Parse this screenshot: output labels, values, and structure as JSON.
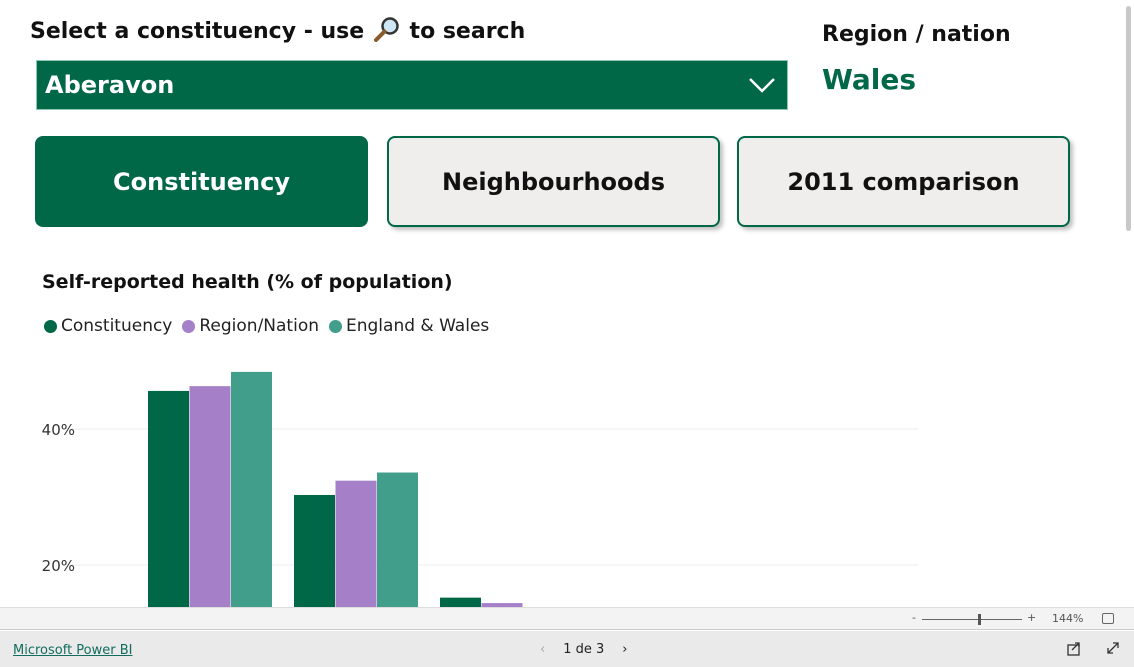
{
  "header": {
    "select_label": "Select a constituency - use",
    "select_label_suffix": "to search",
    "search_icon": "magnifier-icon",
    "dropdown_value": "Aberavon",
    "region_label": "Region / nation",
    "region_value": "Wales"
  },
  "tabs": [
    {
      "label": "Constituency",
      "active": true
    },
    {
      "label": "Neighbourhoods",
      "active": false
    },
    {
      "label": "2011 comparison",
      "active": false
    }
  ],
  "colors": {
    "brand": "#006747",
    "constituency": "#006747",
    "region": "#a580c9",
    "england_wales": "#409e8a"
  },
  "chart_data": {
    "type": "bar",
    "title": "Self-reported health (% of population)",
    "y_ticks": [
      "20%",
      "40%"
    ],
    "grid": true,
    "legend_placement": "top-left",
    "series": [
      {
        "name": "Constituency",
        "values": [
          45.6,
          30.3,
          15.2
        ]
      },
      {
        "name": "Region/Nation",
        "values": [
          46.3,
          32.4,
          14.4
        ]
      },
      {
        "name": "England & Wales",
        "values": [
          48.4,
          33.6,
          null
        ]
      }
    ]
  },
  "zoom": {
    "level": "144%",
    "minus": "-",
    "plus": "+"
  },
  "footer": {
    "brand_link": "Microsoft Power BI",
    "page": "1 de 3"
  }
}
